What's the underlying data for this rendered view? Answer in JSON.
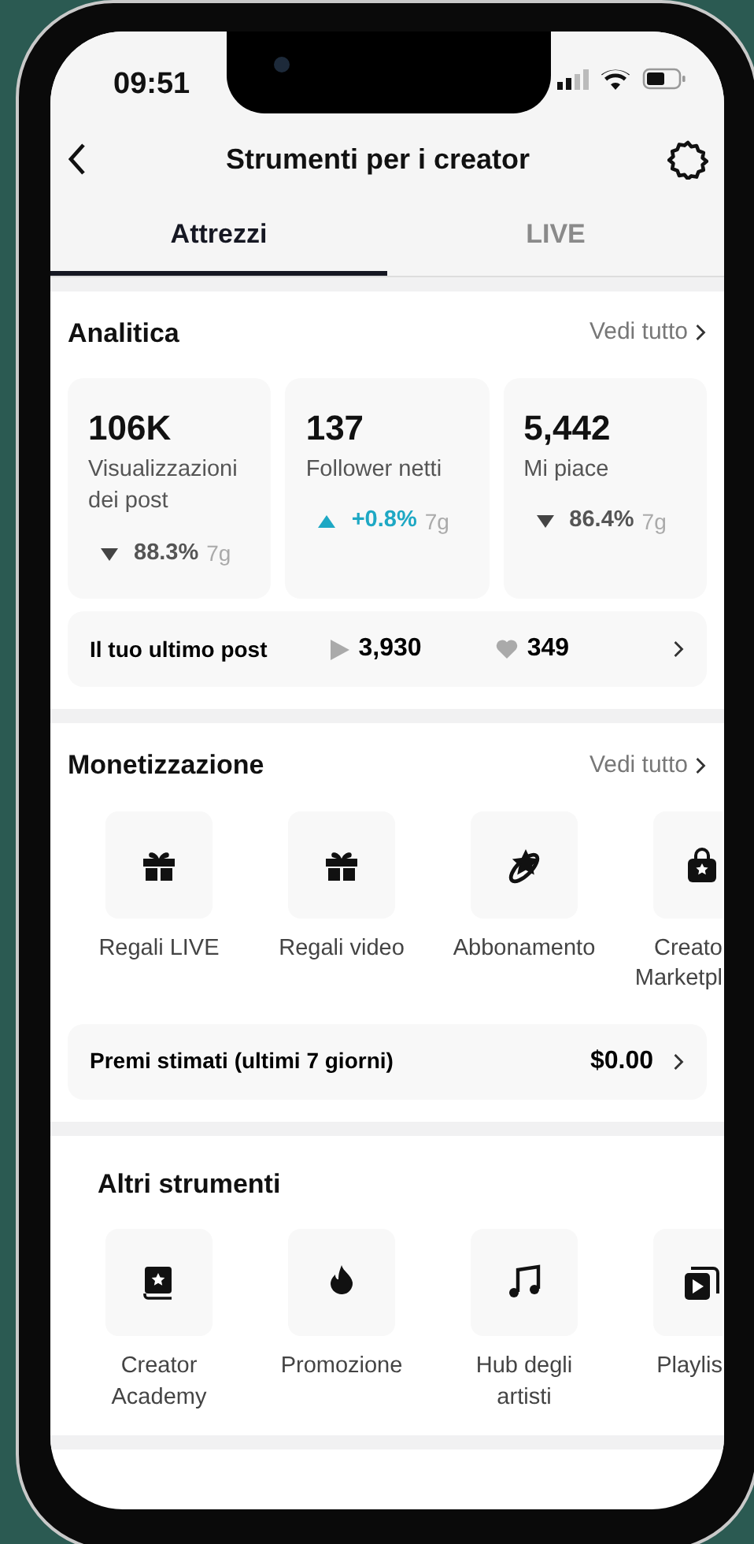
{
  "status_bar": {
    "time": "09:51"
  },
  "header": {
    "title": "Strumenti per i creator"
  },
  "tabs": [
    {
      "label": "Attrezzi",
      "selected": true
    },
    {
      "label": "LIVE",
      "selected": false
    }
  ],
  "analytics": {
    "title": "Analitica",
    "see_all": "Vedi tutto",
    "stats": [
      {
        "value": "106K",
        "label": "Visualizzazioni dei post",
        "kind": "down",
        "change": "88.3%",
        "period": "7g"
      },
      {
        "value": "137",
        "label": "Follower netti",
        "kind": "up",
        "change": "+0.8%",
        "period": "7g"
      },
      {
        "value": "5,442",
        "label": "Mi piace",
        "kind": "down",
        "change": "86.4%",
        "period": "7g"
      }
    ],
    "last_post": {
      "label": "Il tuo ultimo post",
      "plays": "3,930",
      "likes": "349"
    }
  },
  "monetization": {
    "title": "Monetizzazione",
    "see_all": "Vedi tutto",
    "tools": [
      {
        "kind": "gift",
        "label": "Regali LIVE"
      },
      {
        "kind": "gift",
        "label": "Regali video"
      },
      {
        "kind": "planet",
        "label": "Abbonamento"
      },
      {
        "kind": "bag",
        "label": "Creato Marketpl"
      }
    ],
    "rewards": {
      "label": "Premi stimati (ultimi 7 giorni)",
      "amount": "$0.00"
    }
  },
  "other_tools": {
    "title": "Altri strumenti",
    "tools": [
      {
        "kind": "book",
        "label": "Creator Academy"
      },
      {
        "kind": "flame",
        "label": "Promozione"
      },
      {
        "kind": "music",
        "label": "Hub degli artisti"
      },
      {
        "kind": "playlist",
        "label": "Playlis"
      }
    ]
  }
}
